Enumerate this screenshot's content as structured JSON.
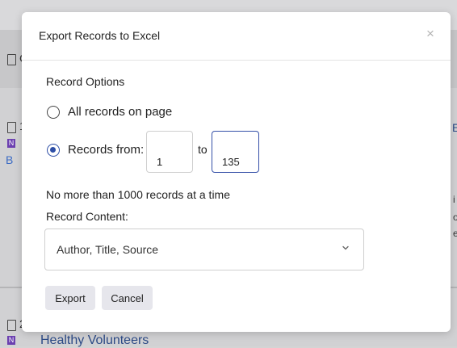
{
  "background": {
    "fragment_header": "C",
    "fragment_row1_left": "1",
    "fragment_row1_right": "E",
    "fragment_row2_left": "2",
    "tag_label": "N",
    "link_icon_text": "B",
    "side_text": [
      "i",
      "o",
      "e"
    ],
    "partial_link": "Healthy Volunteers"
  },
  "dialog": {
    "title": "Export Records to Excel",
    "close_symbol": "×",
    "record_options_label": "Record Options",
    "option_all": "All records on page",
    "option_range": "Records from:",
    "range_from": "1",
    "range_to_label": "to",
    "range_to": "135",
    "limit_note": "No more than 1000 records at a time",
    "record_content_label": "Record Content:",
    "record_content_value": "Author, Title, Source",
    "export_label": "Export",
    "cancel_label": "Cancel",
    "selected_option": "range"
  },
  "colors": {
    "accent": "#2d4ea6",
    "button_bg": "#e6e6ec",
    "overlay_bg": "#d1d1d3",
    "tag_purple": "#6b3fb0"
  }
}
